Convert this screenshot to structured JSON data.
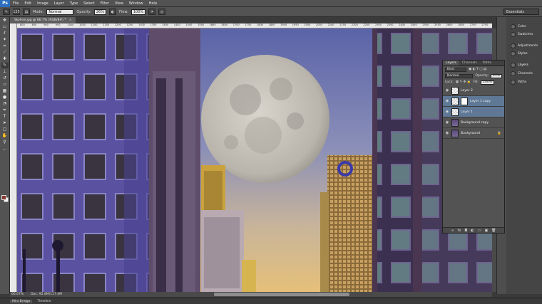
{
  "menubar": {
    "app_icon": "Ps",
    "items": [
      "File",
      "Edit",
      "Image",
      "Layer",
      "Type",
      "Select",
      "Filter",
      "View",
      "Window",
      "Help"
    ]
  },
  "options": {
    "brush_size": "125",
    "mode_label": "Mode:",
    "mode_value": "Normal",
    "opacity_label": "Opacity:",
    "opacity_value": "26%",
    "flow_label": "Flow:",
    "flow_value": "100%",
    "workspace": "Essentials"
  },
  "document": {
    "tab_title": "Skyline.jpg @ 66.7% (RGB/8#) *",
    "tab_close": "×"
  },
  "ruler": {
    "ticks": [
      "800",
      "850",
      "900",
      "950",
      "1000",
      "1050",
      "1100",
      "1150",
      "1200",
      "1250",
      "1300",
      "1350",
      "1400",
      "1450",
      "1500",
      "1550",
      "1600",
      "1650",
      "1700",
      "1750",
      "1800",
      "1850",
      "1900",
      "1950",
      "2000",
      "2050",
      "2100",
      "2150",
      "2200",
      "2250",
      "2300",
      "2350",
      "2400",
      "2450",
      "2500",
      "2550",
      "2600",
      "2650",
      "2700",
      "2750"
    ]
  },
  "status": {
    "zoom": "66.67%",
    "doc_info": "Doc: 95.8M/117.4M"
  },
  "bottom_tabs": [
    "Mini Bridge",
    "Timeline"
  ],
  "dock": {
    "items": [
      "Color",
      "Swatches",
      "Adjustments",
      "Styles",
      "Layers",
      "Channels",
      "Paths"
    ]
  },
  "layers_panel": {
    "tabs": [
      "Layers",
      "Channels",
      "Paths"
    ],
    "filter_kind": "Kind",
    "blend_mode": "Normal",
    "opacity_label": "Opacity:",
    "opacity_value": "45%",
    "lock_label": "Lock:",
    "fill_label": "Fill:",
    "fill_value": "100%",
    "layers": [
      {
        "name": "Layer 2",
        "selected": false,
        "thumb": "transparent"
      },
      {
        "name": "Layer 1 copy",
        "selected": true,
        "thumb": "mask"
      },
      {
        "name": "Layer 1",
        "selected": true,
        "thumb": "transparent"
      },
      {
        "name": "Background copy",
        "selected": false,
        "thumb": "image"
      },
      {
        "name": "Background",
        "selected": false,
        "thumb": "image",
        "locked": true
      }
    ]
  }
}
